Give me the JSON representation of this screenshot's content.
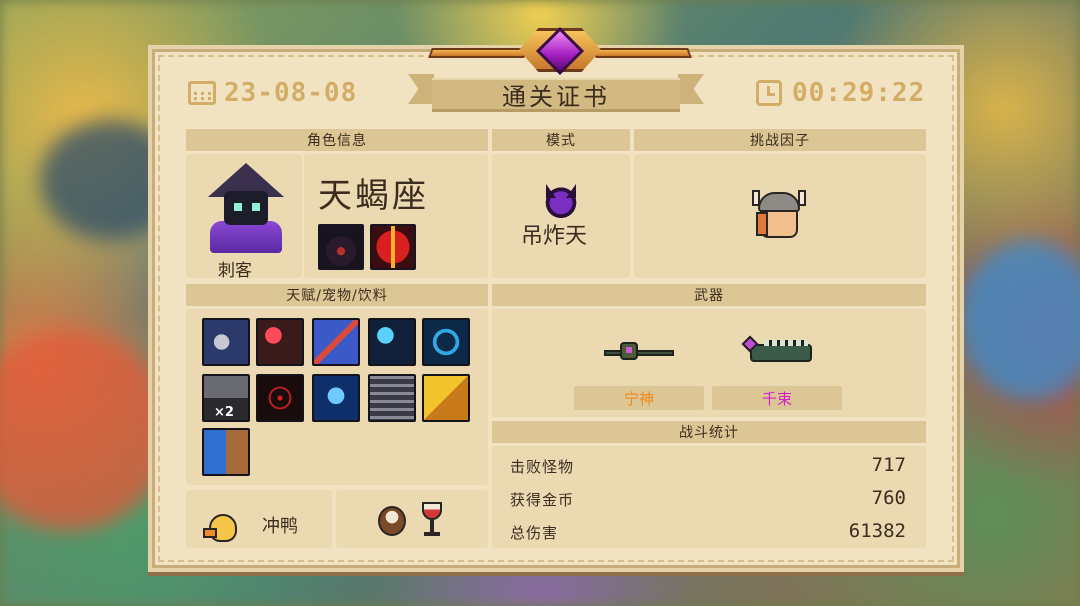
{
  "header": {
    "date": "23-08-08",
    "title": "通关证书",
    "time": "00:29:22"
  },
  "character_info": {
    "section_title": "角色信息",
    "class_name": "刺客",
    "skin_name": "天蝎座",
    "skill_icons": [
      "hooded-shadow-skill-icon",
      "red-blade-skill-icon"
    ]
  },
  "mode": {
    "section_title": "模式",
    "name": "吊炸天",
    "icon": "demon-skull-icon"
  },
  "challenge_factor": {
    "section_title": "挑战因子",
    "icon": "viking-girl-icon"
  },
  "talents": {
    "section_title": "天赋/宠物/饮料",
    "items": [
      {
        "icon": "axe-shield-talent-icon",
        "color": "#2b3a6a"
      },
      {
        "icon": "red-orb-boar-talent-icon",
        "color": "#3a1a1a"
      },
      {
        "icon": "dual-knight-talent-icon",
        "color": "#3b5ac8"
      },
      {
        "icon": "blue-orb-boar-talent-icon",
        "color": "#10203a"
      },
      {
        "icon": "hourglass-talent-icon",
        "color": "#0c2a48"
      },
      {
        "icon": "knight-helmet-x2-talent-icon",
        "color": "#2a2a2e",
        "badge": "×2"
      },
      {
        "icon": "crosshair-talent-icon",
        "color": "#1a0c0c"
      },
      {
        "icon": "blue-mind-talent-icon",
        "color": "#0f2f6a"
      },
      {
        "icon": "clipboard-talent-icon",
        "color": "#3a3a46"
      },
      {
        "icon": "golden-shield-talent-icon",
        "color": "#5a4a10"
      },
      {
        "icon": "blue-shield-talent-icon",
        "color": "#14305a"
      }
    ]
  },
  "pet": {
    "name": "冲鸭",
    "icon": "duck-pet-icon"
  },
  "drinks": {
    "icons": [
      "coconut-drink-icon",
      "wine-glass-drink-icon"
    ]
  },
  "weapons": {
    "section_title": "武器",
    "items": [
      {
        "name": "宁神",
        "color": "#f08a1a",
        "icon": "staff-weapon-icon"
      },
      {
        "name": "千束",
        "color": "#d21fc9",
        "icon": "crocodile-gun-weapon-icon"
      }
    ]
  },
  "battle_stats": {
    "section_title": "战斗统计",
    "rows": [
      {
        "label": "击败怪物",
        "value": "717"
      },
      {
        "label": "获得金币",
        "value": "760"
      },
      {
        "label": "总伤害",
        "value": "61382"
      }
    ]
  }
}
